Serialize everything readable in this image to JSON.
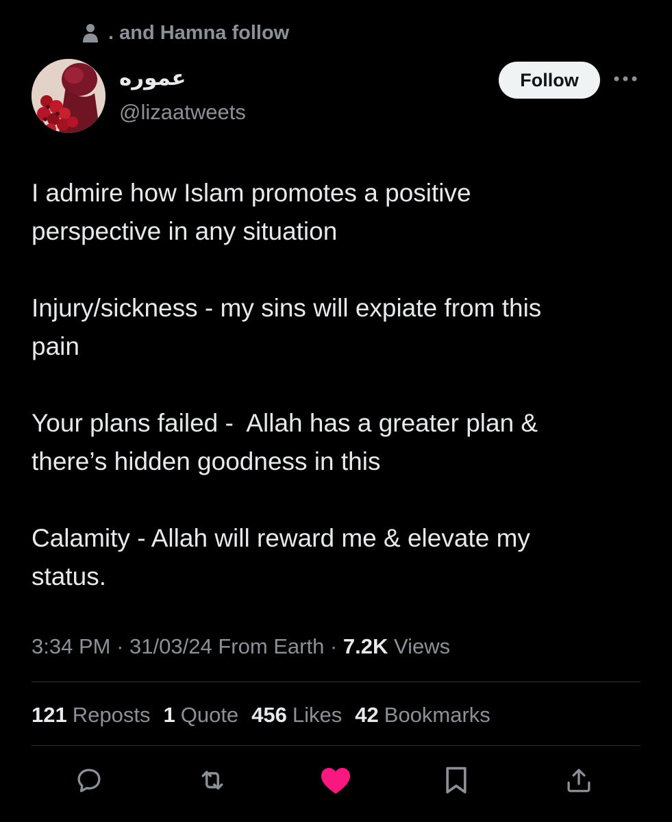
{
  "social_context": {
    "text": ". and Hamna follow",
    "icon": "person-icon"
  },
  "author": {
    "display_name": "عموره",
    "handle": "@lizaatweets",
    "avatar": "rose-bouquet-avatar"
  },
  "follow_button": {
    "label": "Follow"
  },
  "tweet": {
    "paragraphs": [
      "I admire how Islam promotes a positive\nperspective in any situation",
      "Injury/sickness - my sins will expiate from this\npain",
      "Your plans failed -  Allah has a greater plan &\nthere’s hidden goodness in this",
      "Calamity - Allah will reward me & elevate my\nstatus."
    ]
  },
  "meta": {
    "time": "3:34 PM",
    "separator": " · ",
    "date": "31/03/24",
    "source": "From Earth",
    "views_count": "7.2K",
    "views_label": "Views"
  },
  "stats": {
    "reposts": {
      "count": "121",
      "label": "Reposts"
    },
    "quotes": {
      "count": "1",
      "label": "Quote"
    },
    "likes": {
      "count": "456",
      "label": "Likes"
    },
    "bookmarks": {
      "count": "42",
      "label": "Bookmarks"
    }
  },
  "actions": {
    "reply": "reply-icon",
    "repost": "repost-icon",
    "like": "heart-icon",
    "bookmark": "bookmark-icon",
    "share": "share-icon",
    "liked": true
  },
  "colors": {
    "background": "#000000",
    "text_primary": "#e7e9ea",
    "text_secondary": "#8b9197",
    "divider": "#2f3336",
    "like_active": "#f91880",
    "follow_bg": "#eff3f4"
  }
}
